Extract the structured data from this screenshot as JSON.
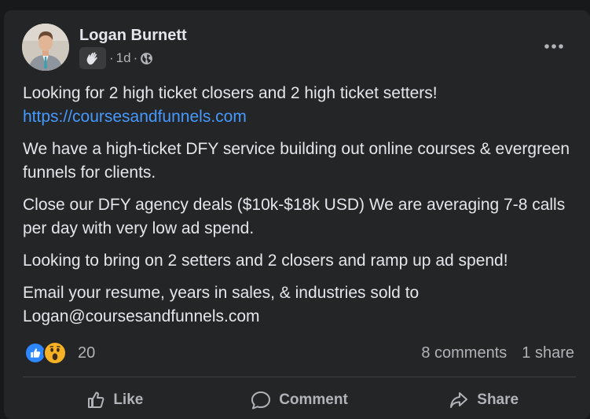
{
  "post": {
    "author": "Logan Burnett",
    "time": "1d",
    "meta_separator": "·",
    "body": {
      "line1": "Looking for 2 high ticket closers and 2 high ticket setters!",
      "link": "https://coursesandfunnels.com",
      "p2": "We have a high-ticket DFY service building out online courses & evergreen funnels for clients.",
      "p3": "Close our DFY agency deals ($10k-$18k USD)  We are averaging 7-8 calls per day with very low ad spend.",
      "p4": "Looking to bring on 2 setters and 2 closers and ramp up ad spend!",
      "p5": "Email your resume, years in sales, & industries sold to Logan@coursesandfunnels.com"
    },
    "reactions": {
      "count": "20",
      "types": [
        "like",
        "wow"
      ]
    },
    "comments_label": "8 comments",
    "shares_label": "1 share",
    "actions": {
      "like": "Like",
      "comment": "Comment",
      "share": "Share"
    }
  },
  "icons": {
    "badge": "waving-hand-icon",
    "privacy": "globe-icon",
    "menu": "more-dots-icon"
  },
  "colors": {
    "background": "#18191a",
    "card": "#242526",
    "link": "#4599ff",
    "text": "#e4e6eb",
    "secondary_text": "#b0b3b8",
    "like_blue": "#2d88ff",
    "wow_yellow": "#f7b125"
  }
}
